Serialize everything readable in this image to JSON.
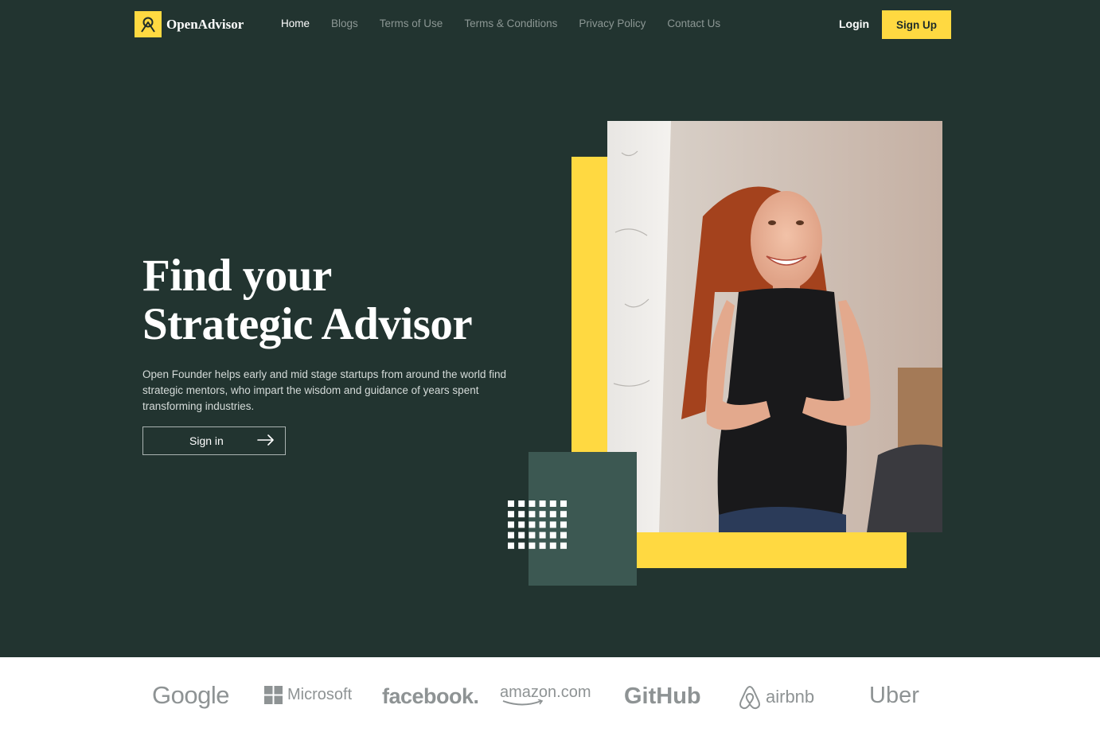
{
  "header": {
    "logo_text": "OpenAdvisor",
    "nav": [
      "Home",
      "Blogs",
      "Terms of Use",
      "Terms & Conditions",
      "Privacy Policy",
      "Contact Us"
    ],
    "active_nav": "Home",
    "login_label": "Login",
    "signup_label": "Sign Up"
  },
  "hero": {
    "title_line1": "Find your",
    "title_line2": "Strategic Advisor",
    "description": "Open Founder helps early and mid stage startups from around the world find strategic mentors, who impart the wisdom and guidance of years spent transforming industries.",
    "cta_label": "Sign in",
    "cta_icon": "arrow-right-icon"
  },
  "brands": [
    "Google",
    "Microsoft",
    "facebook.",
    "amazon.com",
    "GitHub",
    "airbnb",
    "Uber"
  ],
  "colors": {
    "background": "#223430",
    "accent": "#ffd941",
    "teal_block": "#3c5852",
    "brand_gray": "#8e9394"
  }
}
